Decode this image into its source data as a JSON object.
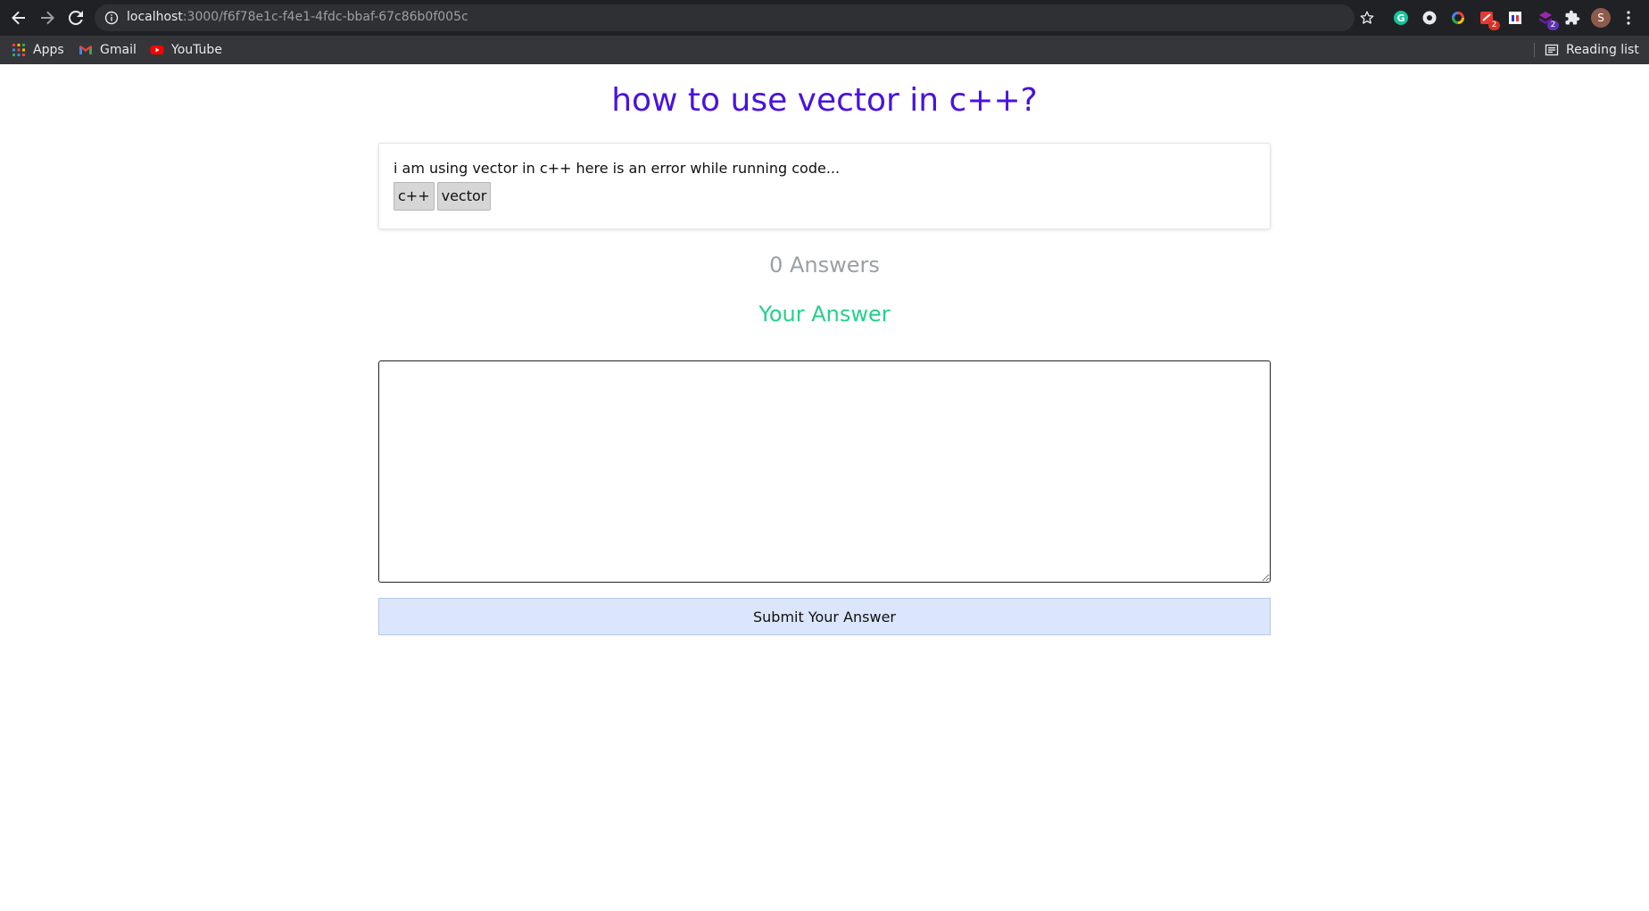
{
  "browser": {
    "url_host": "localhost",
    "url_path": ":3000/f6f78e1c-f4e1-4fdc-bbaf-67c86b0f005c",
    "avatar_letter": "S",
    "extensions": [
      {
        "name": "grammarly-icon",
        "color": "#15c39a",
        "badge": ""
      },
      {
        "name": "extension-circle-icon",
        "color": "#e8eaed",
        "badge": ""
      },
      {
        "name": "color-wheel-icon",
        "color": "#4285f4",
        "badge": ""
      },
      {
        "name": "calendar-extension-icon",
        "color": "#e53935",
        "badge": "2"
      },
      {
        "name": "flag-extension-icon",
        "color": "#ffffff",
        "badge": ""
      },
      {
        "name": "purple-extension-icon",
        "color": "#7b1fa2",
        "badge": "2"
      },
      {
        "name": "puzzle-icon",
        "color": "#e8eaed",
        "badge": ""
      }
    ]
  },
  "bookmarks": {
    "apps": "Apps",
    "gmail": "Gmail",
    "youtube": "YouTube",
    "reading_list": "Reading list"
  },
  "question": {
    "title": "how to use vector in c++?",
    "body": "i am using vector in c++ here is an error while running code...",
    "tags": [
      "c++",
      "vector"
    ]
  },
  "answers": {
    "count_label": "0 Answers",
    "your_answer_heading": "Your Answer",
    "input_value": "",
    "submit_label": "Submit Your Answer"
  },
  "colors": {
    "title": "#4a12e0",
    "your_answer": "#25d08a",
    "answers_count": "#9aa0a6",
    "submit_bg": "#dbe6fd"
  }
}
